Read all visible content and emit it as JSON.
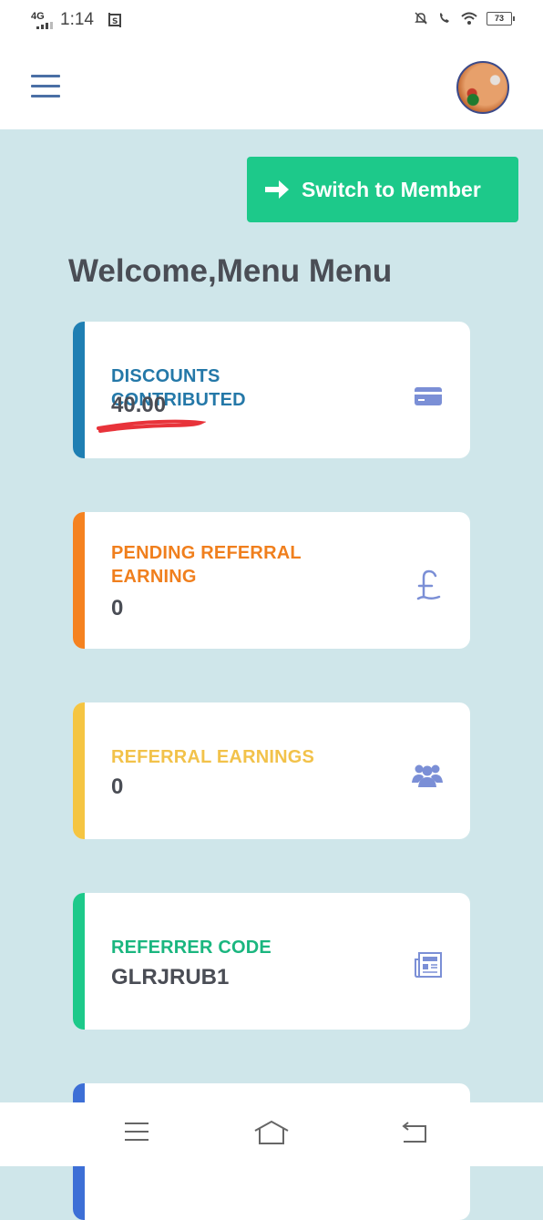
{
  "status_bar": {
    "network": "4G",
    "time": "1:14",
    "battery": "73"
  },
  "header": {
    "menu_icon": "hamburger-menu-icon",
    "avatar_icon": "user-avatar"
  },
  "switch_button": {
    "label": "Switch to Member",
    "icon": "arrow-right-icon"
  },
  "welcome_text": "Welcome,Menu Menu",
  "cards": [
    {
      "title": "DISCOUNTS CONTRIBUTED",
      "value": "40.00",
      "color": "#2478a8",
      "accent": "#1f7fb3",
      "icon": "credit-card-icon"
    },
    {
      "title": "PENDING REFERRAL EARNING",
      "value": "0",
      "color": "#f07f1d",
      "accent": "#f58220",
      "icon": "pound-sterling-icon"
    },
    {
      "title": "REFERRAL EARNINGS",
      "value": "0",
      "color": "#f2c24a",
      "accent": "#f5c542",
      "icon": "users-icon"
    },
    {
      "title": "REFERRER CODE",
      "value": "GLRJRUB1",
      "color": "#1ab67f",
      "accent": "#1dc98a",
      "icon": "newspaper-icon"
    },
    {
      "title": "",
      "value": "",
      "color": "#3d6fd6",
      "accent": "#3d6fd6",
      "icon": ""
    }
  ],
  "bottom_nav": {
    "items": [
      "menu-icon",
      "home-icon",
      "back-icon"
    ]
  },
  "colors": {
    "page_bg": "#cfe6ea",
    "primary_green": "#1dc98a",
    "text_dark": "#4a4d55",
    "icon_purple": "#7b8fd6"
  }
}
